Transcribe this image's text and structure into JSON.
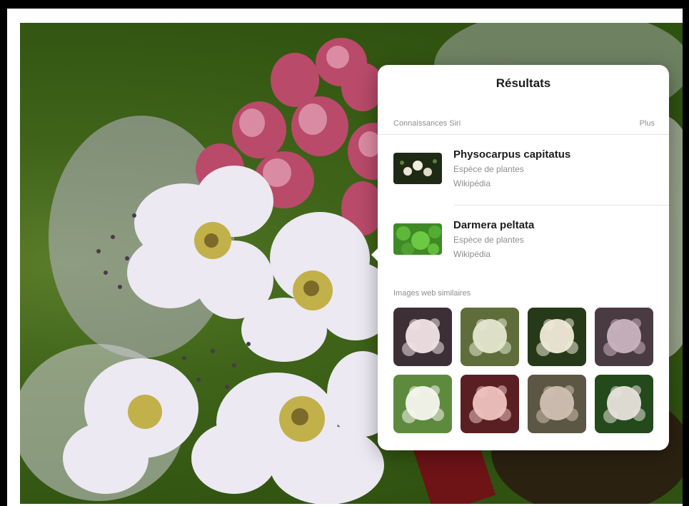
{
  "panel": {
    "title": "Résultats",
    "section_label": "Connaissances Siri",
    "more_label": "Plus",
    "results": [
      {
        "name": "Physocarpus capitatus",
        "subtitle": "Espèce de plantes",
        "source": "Wikipédia",
        "thumb_icon": "white-flower-cluster-thumbnail"
      },
      {
        "name": "Darmera peltata",
        "subtitle": "Espèce de plantes",
        "source": "Wikipédia",
        "thumb_icon": "green-leaves-thumbnail"
      }
    ],
    "similar_label": "Images web similaires",
    "similar_images": [
      {
        "icon": "pink-flower-ball-image",
        "bg": "#3c2f35",
        "flower": "#f1e4e6"
      },
      {
        "icon": "white-flower-bush-image",
        "bg": "#5f6d3b",
        "flower": "#e4e7cf"
      },
      {
        "icon": "white-flower-dark-leaves-image",
        "bg": "#263a19",
        "flower": "#f0ead8"
      },
      {
        "icon": "mauve-flower-ball-image",
        "bg": "#4a3a42",
        "flower": "#c8b3bf"
      },
      {
        "icon": "white-flowers-green-bush-image",
        "bg": "#5e8a3d",
        "flower": "#f5f5ee"
      },
      {
        "icon": "pink-flower-dark-red-image",
        "bg": "#5a1f22",
        "flower": "#efc3c1"
      },
      {
        "icon": "faded-flower-cluster-image",
        "bg": "#5c5744",
        "flower": "#cfc0b3"
      },
      {
        "icon": "white-flower-green-leaves-image",
        "bg": "#244a1c",
        "flower": "#e8e2dc"
      }
    ]
  },
  "photo": {
    "icon": "physocarpus-flower-photo",
    "background_color": "#3f6419"
  }
}
